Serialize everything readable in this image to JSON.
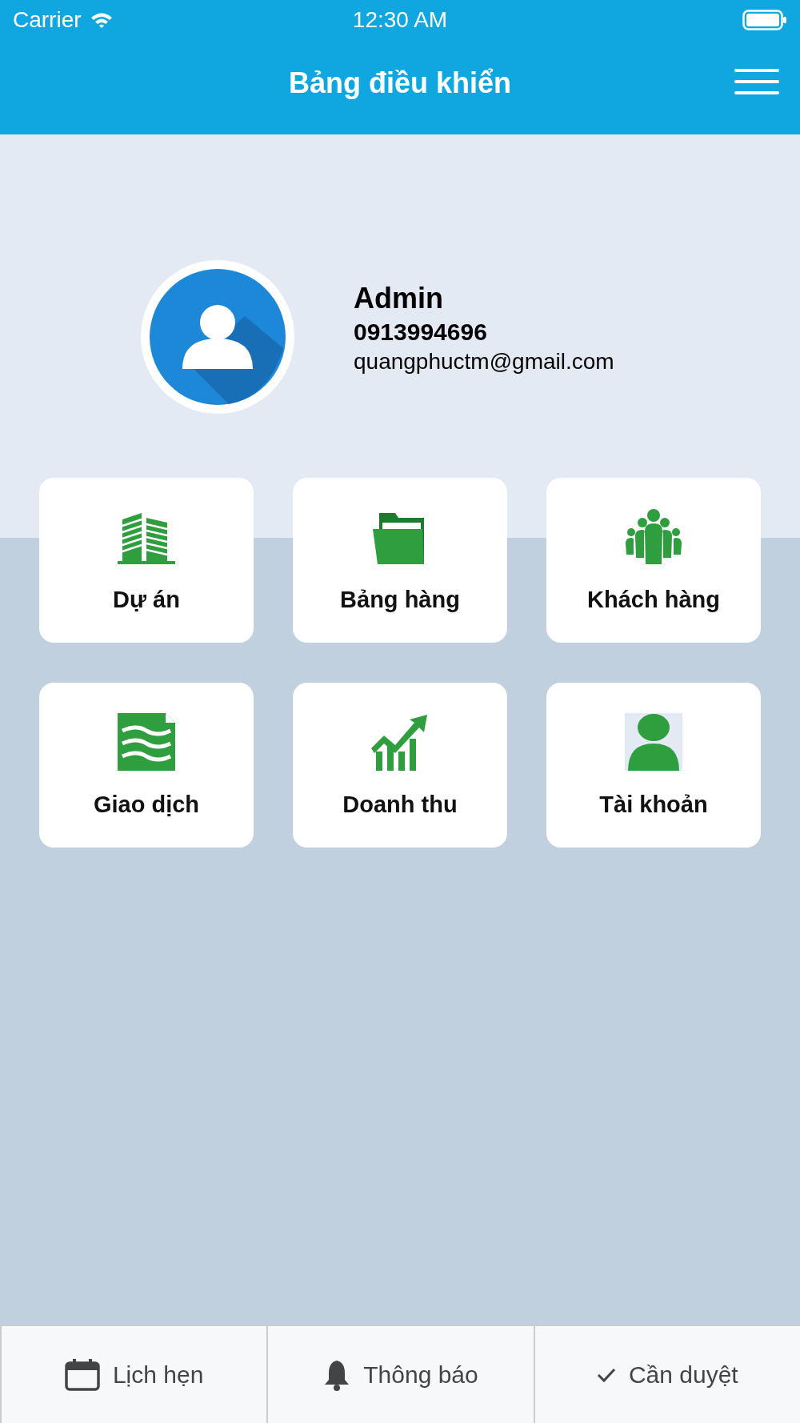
{
  "status_bar": {
    "carrier": "Carrier",
    "time": "12:30 AM"
  },
  "header": {
    "title": "Bảng điều khiển"
  },
  "profile": {
    "name": "Admin",
    "phone": "0913994696",
    "email": "quangphuctm@gmail.com"
  },
  "tiles": [
    {
      "kind": "buildings",
      "label": "Dự án"
    },
    {
      "kind": "folder",
      "label": "Bảng hàng"
    },
    {
      "kind": "people",
      "label": "Khách hàng"
    },
    {
      "kind": "document",
      "label": "Giao dịch"
    },
    {
      "kind": "chart",
      "label": "Doanh thu"
    },
    {
      "kind": "person",
      "label": "Tài khoản"
    }
  ],
  "tab_bar": [
    {
      "kind": "calendar",
      "label": "Lịch hẹn"
    },
    {
      "kind": "bell",
      "label": "Thông báo"
    },
    {
      "kind": "check",
      "label": "Cần duyệt"
    }
  ]
}
